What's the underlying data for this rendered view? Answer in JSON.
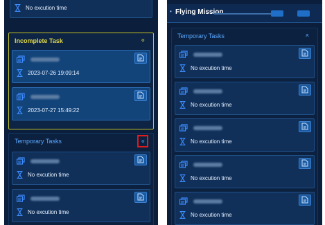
{
  "left": {
    "top_card": {
      "time_text": "No excution time"
    },
    "incomplete": {
      "title": "Incomplete Task",
      "chevron": "»",
      "cards": [
        {
          "time_text": "2023-07-26 19:09:14"
        },
        {
          "time_text": "2023-07-27 15:49:22"
        }
      ]
    },
    "temporary": {
      "title": "Temporary Tasks",
      "chevron": "»",
      "cards": [
        {
          "time_text": "No excution time"
        },
        {
          "time_text": "No excution time"
        }
      ]
    }
  },
  "right": {
    "header_title": "Flying Mission",
    "temporary": {
      "title": "Temporary Tasks",
      "chevron": "«",
      "cards": [
        {
          "time_text": "No excution time"
        },
        {
          "time_text": "No excution time"
        },
        {
          "time_text": "No excution time"
        },
        {
          "time_text": "No excution time"
        },
        {
          "time_text": "No excution time"
        }
      ]
    }
  },
  "colors": {
    "panel_bg": "#0b1e3b",
    "incomplete_border": "#c7c32a",
    "incomplete_title": "#e0d94a",
    "temporary_title": "#5aa8ff",
    "highlight_box": "#e01b1b",
    "accent": "#1a5aa0"
  },
  "icons": [
    "task-icon",
    "hourglass-icon",
    "document-icon",
    "double-chevron-icon"
  ]
}
